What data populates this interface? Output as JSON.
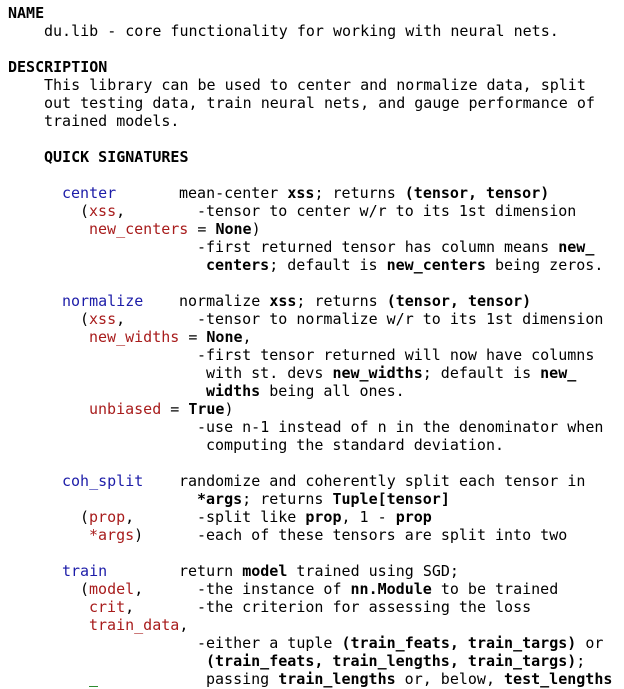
{
  "name": {
    "header": "NAME",
    "summary": "du.lib - core functionality for working with neural nets."
  },
  "description": {
    "header": "DESCRIPTION",
    "lines": [
      "This library can be used to center and normalize data, split",
      "out testing data, train neural nets, and gauge performance of",
      "trained models."
    ]
  },
  "quick_signatures_header": "QUICK SIGNATURES",
  "center": {
    "name": "center",
    "summary_pre": "mean-center ",
    "summary_arg": "xss",
    "summary_mid": "; returns ",
    "summary_ret": "(tensor, tensor)",
    "open": "(",
    "p1": "xss",
    "p1_sep": ",",
    "p1_desc": "-tensor to center w/r to its 1st dimension",
    "p2": "new_centers",
    "p2_eq": " = ",
    "p2_default": "None",
    "close": ")",
    "p2_desc1_a": "-first returned tensor has column means ",
    "p2_desc1_b": "new_",
    "p2_desc2_a": "centers",
    "p2_desc2_b": "; default is ",
    "p2_desc2_c": "new_centers",
    "p2_desc2_d": " being zeros."
  },
  "normalize": {
    "name": "normalize",
    "summary_pre": "normalize ",
    "summary_arg": "xss",
    "summary_mid": "; returns ",
    "summary_ret": "(tensor, tensor)",
    "open": "(",
    "p1": "xss",
    "p1_sep": ",",
    "p1_desc": "-tensor to normalize w/r to its 1st dimension",
    "p2": "new_widths",
    "p2_eq": " = ",
    "p2_default": "None",
    "p2_sep": ",",
    "p2_desc1": "-first tensor returned will now have columns",
    "p2_desc2_a": "with st. devs ",
    "p2_desc2_b": "new_widths",
    "p2_desc2_c": "; default is ",
    "p2_desc2_d": "new_",
    "p2_desc3_a": "widths",
    "p2_desc3_b": " being all ones.",
    "p3": "unbiased",
    "p3_eq": " = ",
    "p3_default": "True",
    "close": ")",
    "p3_desc1": "-use n-1 instead of n in the denominator when",
    "p3_desc2": "computing the standard deviation."
  },
  "coh_split": {
    "name": "coh_split",
    "summary1": "randomize and coherently split each tensor in",
    "summary2_a": "*args",
    "summary2_b": "; returns ",
    "summary2_c": "Tuple[tensor]",
    "open": "(",
    "p1": "prop",
    "p1_sep": ",",
    "p1_desc_a": "-split like ",
    "p1_desc_b": "prop",
    "p1_desc_c": ", 1 - ",
    "p1_desc_d": "prop",
    "p2": "*args",
    "close": ")",
    "p2_desc": "-each of these tensors are split into two"
  },
  "train": {
    "name": "train",
    "summary_a": "return ",
    "summary_b": "model",
    "summary_c": " trained using SGD;",
    "open": "(",
    "p1": "model",
    "p1_sep": ",",
    "p1_desc_a": "-the instance of ",
    "p1_desc_b": "nn.Module",
    "p1_desc_c": " to be trained",
    "p2": "crit",
    "p2_sep": ",",
    "p2_desc": "-the criterion for assessing the loss",
    "p3": "train_data",
    "p3_sep": ",",
    "p3_desc1_a": "-either a tuple ",
    "p3_desc1_b": "(train_feats, train_targs)",
    "p3_desc1_c": " or",
    "p3_desc2_a": "(train_feats, train_lengths, train_targs)",
    "p3_desc2_b": ";",
    "p3_desc3_a": "passing ",
    "p3_desc3_b": "train_lengths",
    "p3_desc3_c": " or, below, ",
    "p3_desc3_d": "test_lengths"
  },
  "colors": {
    "function_name": "#1c1ca8",
    "parameter": "#a81c1c",
    "text": "#000000",
    "background": "#ffffff"
  }
}
